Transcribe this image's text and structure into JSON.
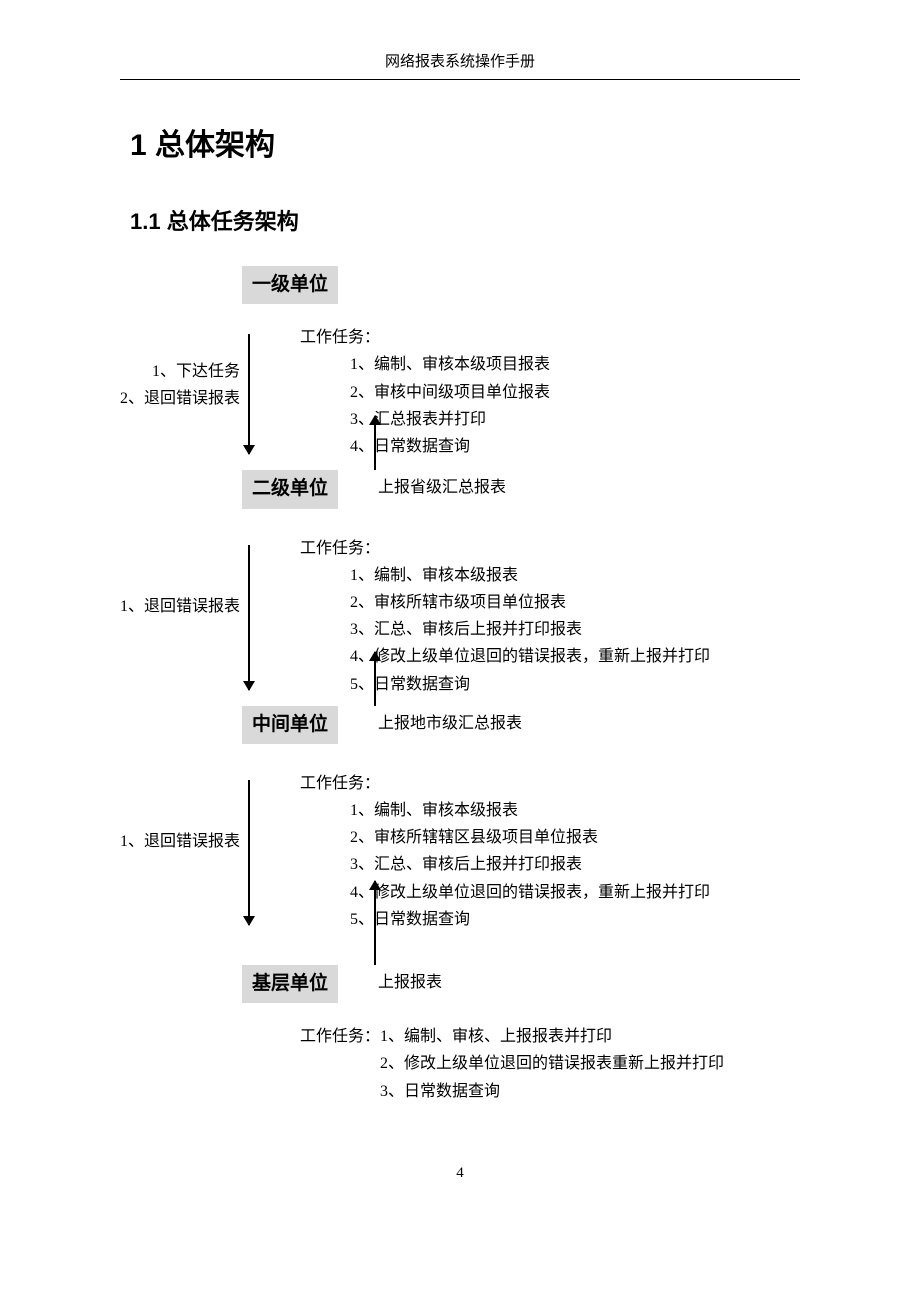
{
  "header": "网络报表系统操作手册",
  "h1": "1  总体架构",
  "h2": "1.1 总体任务架构",
  "page_number": "4",
  "units": {
    "u1": "一级单位",
    "u2": "二级单位",
    "u3": "中间单位",
    "u4": "基层单位"
  },
  "task_title": "工作任务：",
  "block1": {
    "left1": "1、下达任务",
    "left2": "2、退回错误报表",
    "t1": "1、编制、审核本级项目报表",
    "t2": "2、审核中间级项目单位报表",
    "t3": "3、汇总报表并打印",
    "t4": "4、日常数据查询"
  },
  "up1": "上报省级汇总报表",
  "block2": {
    "left1": "1、退回错误报表",
    "t1": "1、编制、审核本级报表",
    "t2": "2、审核所辖市级项目单位报表",
    "t3": "3、汇总、审核后上报并打印报表",
    "t4": "4、修改上级单位退回的错误报表，重新上报并打印",
    "t5": "5、日常数据查询"
  },
  "up2": "上报地市级汇总报表",
  "block3": {
    "left1": "1、退回错误报表",
    "t1": "1、编制、审核本级报表",
    "t2": "2、审核所辖辖区县级项目单位报表",
    "t3": "3、汇总、审核后上报并打印报表",
    "t4": "4、修改上级单位退回的错误报表，重新上报并打印",
    "t5": "5、日常数据查询"
  },
  "up3": "上报报表",
  "block4": {
    "prefix": "工作任务：",
    "t1": "1、编制、审核、上报报表并打印",
    "t2": "2、修改上级单位退回的错误报表重新上报并打印",
    "t3": "3、日常数据查询"
  }
}
